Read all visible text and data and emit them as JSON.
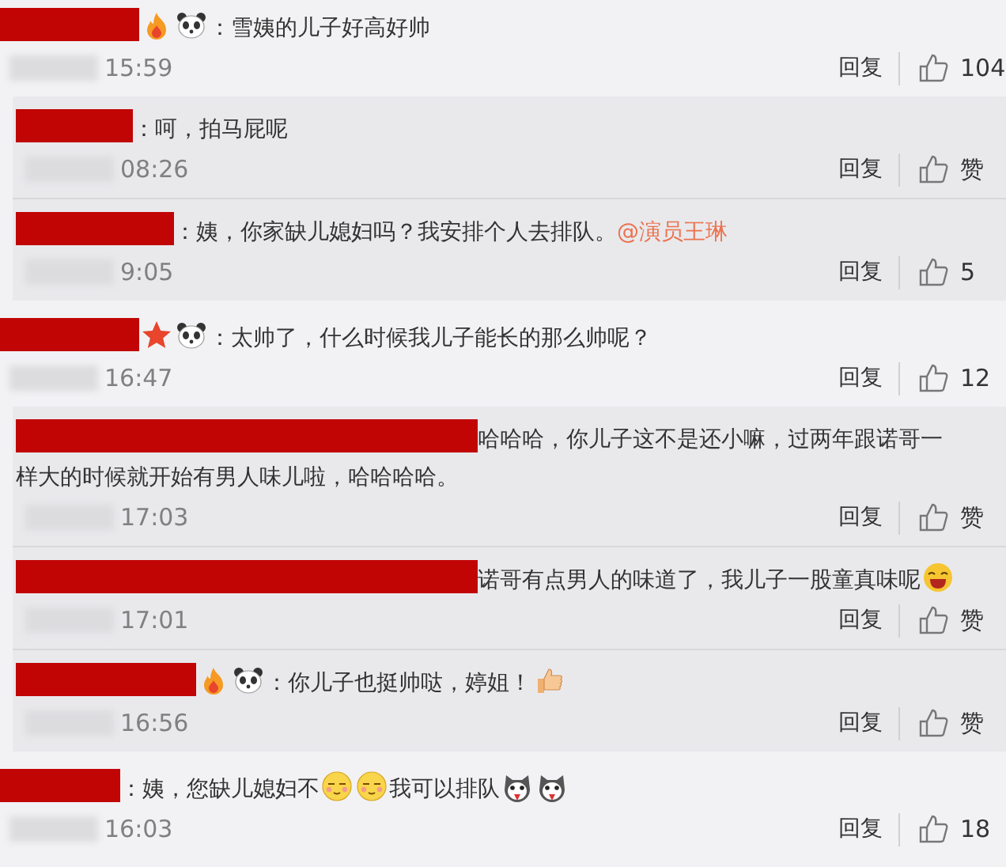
{
  "comments": [
    {
      "kind": "comment",
      "parts": [
        {
          "kind": "fire"
        },
        {
          "kind": "panda"
        },
        {
          "kind": "text",
          "text": "：雪姨的儿子好高好帅"
        }
      ],
      "time": "15:59",
      "reply": "回复",
      "likes": "104"
    },
    {
      "kind": "reply",
      "parts": [
        {
          "kind": "text",
          "text": "：呵，拍马屁呢"
        }
      ],
      "time": "08:26",
      "reply": "回复",
      "likes": "赞"
    },
    {
      "kind": "reply",
      "parts": [
        {
          "kind": "text",
          "text": "：姨，你家缺儿媳妇吗？我安排个人去排队。"
        },
        {
          "kind": "mention",
          "text": "@演员王琳"
        }
      ],
      "time": "9:05",
      "reply": "回复",
      "likes": "5"
    },
    {
      "kind": "comment",
      "parts": [
        {
          "kind": "star"
        },
        {
          "kind": "panda"
        },
        {
          "kind": "text",
          "text": "：太帅了，什么时候我儿子能长的那么帅呢？"
        }
      ],
      "time": "16:47",
      "reply": "回复",
      "likes": "12"
    },
    {
      "kind": "reply",
      "parts": [
        {
          "kind": "text",
          "text": "哈哈哈，你儿子这不是还小嘛，过两年跟诺哥一"
        },
        {
          "kind": "text",
          "text": "样大的时候就开始有男人味儿啦，哈哈哈哈。"
        }
      ],
      "time": "17:03",
      "reply": "回复",
      "likes": "赞"
    },
    {
      "kind": "reply",
      "parts": [
        {
          "kind": "text",
          "text": "诺哥有点男人的味道了，我儿子一股童真味呢"
        },
        {
          "kind": "laugh"
        }
      ],
      "time": "17:01",
      "reply": "回复",
      "likes": "赞"
    },
    {
      "kind": "reply",
      "parts": [
        {
          "kind": "fire"
        },
        {
          "kind": "panda"
        },
        {
          "kind": "text",
          "text": "：你儿子也挺帅哒，婷姐！"
        },
        {
          "kind": "thumb"
        }
      ],
      "time": "16:56",
      "reply": "回复",
      "likes": "赞"
    },
    {
      "kind": "comment",
      "parts": [
        {
          "kind": "text",
          "text": "：姨，您缺儿媳妇不"
        },
        {
          "kind": "smug"
        },
        {
          "kind": "smug"
        },
        {
          "kind": "text",
          "text": "我可以排队"
        },
        {
          "kind": "husky"
        },
        {
          "kind": "husky"
        }
      ],
      "time": "16:03",
      "reply": "回复",
      "likes": "18"
    }
  ]
}
